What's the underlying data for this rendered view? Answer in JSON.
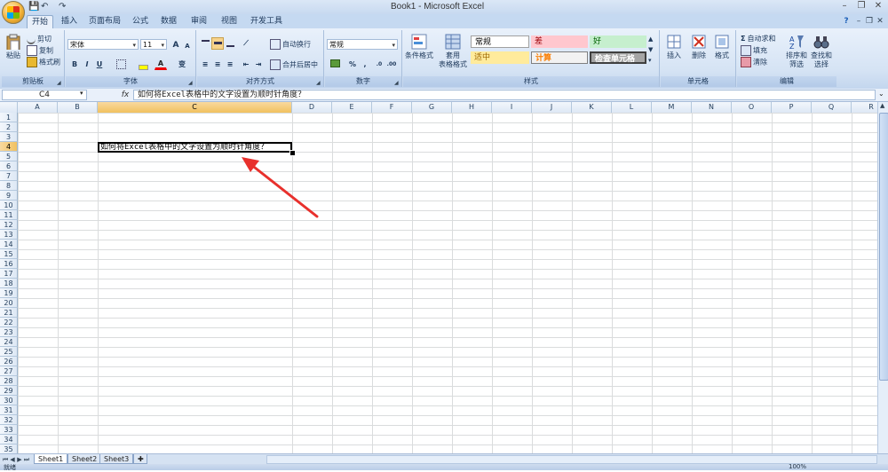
{
  "window": {
    "title": "Book1 - Microsoft Excel",
    "undo_glyph": "↶",
    "redo_glyph": "↷",
    "save_glyph": "💾",
    "minimize": "–",
    "restore": "❐",
    "close": "✕",
    "help_glyph": "?"
  },
  "tabs": [
    {
      "label": "开始",
      "active": true
    },
    {
      "label": "插入"
    },
    {
      "label": "页面布局"
    },
    {
      "label": "公式"
    },
    {
      "label": "数据"
    },
    {
      "label": "审阅"
    },
    {
      "label": "视图"
    },
    {
      "label": "开发工具"
    }
  ],
  "ribbon": {
    "clipboard": {
      "label": "剪贴板",
      "paste": "粘贴",
      "cut": "剪切",
      "copy": "复制",
      "format_painter": "格式刷"
    },
    "font": {
      "label": "字体",
      "font_name": "宋体",
      "font_size": "11",
      "grow": "A",
      "shrink": "A",
      "bold": "B",
      "italic": "I",
      "underline": "U",
      "font_color_glyph": "A",
      "wen_glyph": "变"
    },
    "alignment": {
      "label": "对齐方式",
      "wrap_text": "自动换行",
      "merge_center": "合并后居中"
    },
    "number": {
      "label": "数字",
      "format": "常规",
      "percent": "%",
      "comma": ","
    },
    "styles": {
      "label": "样式",
      "conditional": "条件格式",
      "table_line1": "套用",
      "table_line2": "表格格式",
      "normal": "常规",
      "bad": "差",
      "good": "好",
      "neutral": "适中",
      "calc": "计算",
      "check": "检查单元格"
    },
    "cells": {
      "label": "单元格",
      "insert": "插入",
      "delete": "删除",
      "format": "格式"
    },
    "editing": {
      "label": "编辑",
      "autosum": "自动求和",
      "fill": "填充",
      "clear": "清除",
      "sort_line1": "排序和",
      "sort_line2": "筛选",
      "find_line1": "查找和",
      "find_line2": "选择"
    }
  },
  "formula_bar": {
    "name_box": "C4",
    "fx": "fx",
    "content": "如何将Excel表格中的文字设置为顺时针角度？"
  },
  "grid": {
    "columns": [
      "A",
      "B",
      "C",
      "D",
      "E",
      "F",
      "G",
      "H",
      "I",
      "J",
      "K",
      "L",
      "M",
      "N",
      "O",
      "P",
      "Q",
      "R"
    ],
    "rows": [
      "1",
      "2",
      "3",
      "4",
      "5",
      "6",
      "7",
      "8",
      "9",
      "10",
      "11",
      "12",
      "13",
      "14",
      "15",
      "16",
      "17",
      "18",
      "19",
      "20",
      "21",
      "22",
      "23",
      "24",
      "25",
      "26",
      "27",
      "28",
      "29",
      "30",
      "31",
      "32",
      "33",
      "34",
      "35"
    ],
    "selected_column": "C",
    "selected_row": "4",
    "cell_c4": "如何将Excel表格中的文字设置为顺时针角度？"
  },
  "sheets": [
    {
      "label": "Sheet1",
      "active": true
    },
    {
      "label": "Sheet2"
    },
    {
      "label": "Sheet3"
    }
  ],
  "status": {
    "ready": "就绪",
    "zoom": "100%"
  },
  "colors": {
    "accent": "#e8302c",
    "selection_header": "#f1c15f"
  }
}
